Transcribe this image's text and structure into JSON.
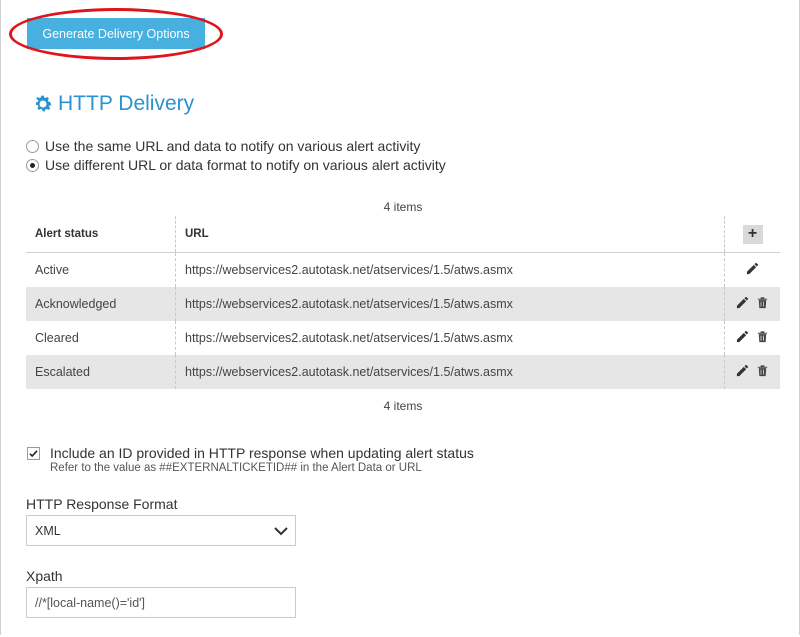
{
  "toolbar": {
    "generate_label": "Generate Delivery Options"
  },
  "section": {
    "title": "HTTP Delivery",
    "icon": "gear-icon",
    "accent": "#2b92cf"
  },
  "radios": [
    {
      "label": "Use the same URL and data to notify on various alert activity",
      "checked": false
    },
    {
      "label": "Use different URL or data format to notify on various alert activity",
      "checked": true
    }
  ],
  "table": {
    "count_top": "4 items",
    "count_bottom": "4 items",
    "headers": {
      "status": "Alert status",
      "url": "URL"
    },
    "rows": [
      {
        "status": "Active",
        "url": "https://webservices2.autotask.net/atservices/1.5/atws.asmx"
      },
      {
        "status": "Acknowledged",
        "url": "https://webservices2.autotask.net/atservices/1.5/atws.asmx"
      },
      {
        "status": "Cleared",
        "url": "https://webservices2.autotask.net/atservices/1.5/atws.asmx"
      },
      {
        "status": "Escalated",
        "url": "https://webservices2.autotask.net/atservices/1.5/atws.asmx"
      }
    ]
  },
  "include_id": {
    "checked": true,
    "label": "Include an ID provided in HTTP response when updating alert status",
    "help": "Refer to the value as ##EXTERNALTICKETID## in the Alert Data or URL"
  },
  "response_format": {
    "label": "HTTP Response Format",
    "value": "XML"
  },
  "xpath": {
    "label": "Xpath",
    "value": "//*[local-name()='id']"
  },
  "colors": {
    "button": "#47b0de",
    "highlight": "#e0141b",
    "row_alt": "#e6e6e6"
  }
}
